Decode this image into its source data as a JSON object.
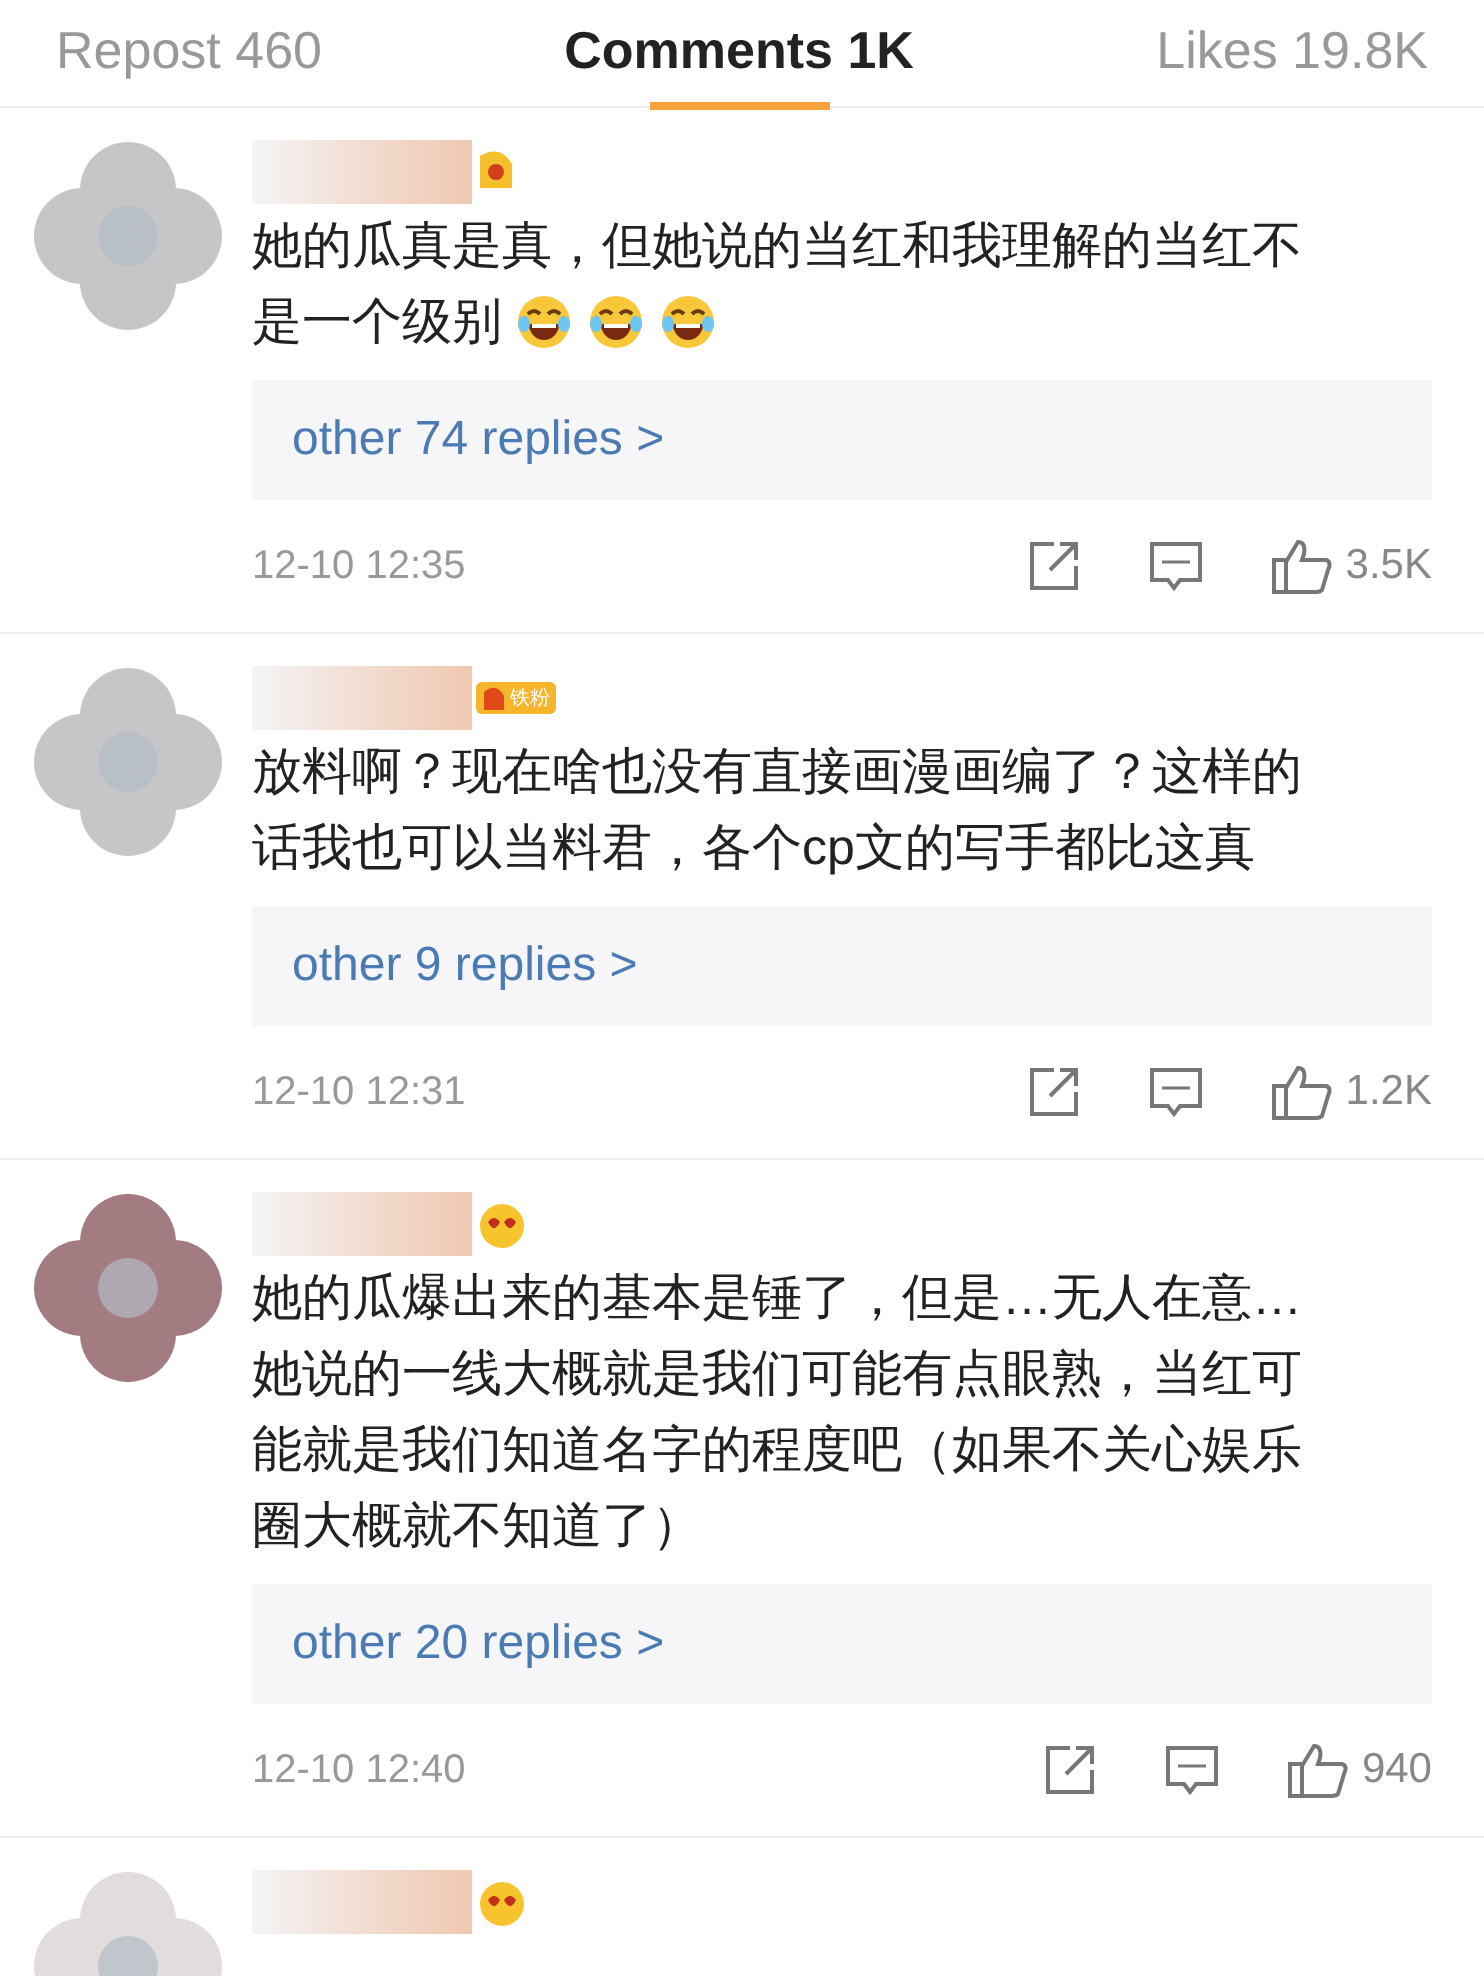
{
  "tabs": [
    {
      "label": "Repost 460",
      "selected": false
    },
    {
      "label": "Comments 1K",
      "selected": true
    },
    {
      "label": "Likes 19.8K",
      "selected": false
    }
  ],
  "comments": [
    {
      "color": "#c6c6c8",
      "badge": {
        "kind": "vip"
      },
      "lines": [
        "她的瓜真是真，但她说的当红和我理解的当红不",
        "是一个级别"
      ],
      "emojis": [
        {
          "kind": "laugh"
        },
        {
          "kind": "laugh"
        },
        {
          "kind": "laugh"
        }
      ],
      "replies": "other 74 replies >",
      "time": "12-10 12:35",
      "likes": "3.5K"
    },
    {
      "color": "#c6c6c8",
      "badge": {
        "kind": "fan",
        "label": "铁粉"
      },
      "text": "放料啊？现在啥也没有直接画漫画编了？这样的话我也可以当料君，各个cp文的写手都比这真",
      "replies": "other 9 replies >",
      "time": "12-10 12:31",
      "likes": "1.2K"
    },
    {
      "color": "#a27c80",
      "badge": {
        "kind": "emoji"
      },
      "text": "她的瓜爆出来的基本是锤了，但是…无人在意…她说的一线大概就是我们可能有点眼熟，当红可能就是我们知道名字的程度吧（如果不关心娱乐圈大概就不知道了）",
      "replies": "other 20 replies >",
      "time": "12-10 12:40",
      "likes": "940"
    },
    {
      "color": "#e2dcdc",
      "badge": {
        "kind": "emoji"
      }
    }
  ]
}
